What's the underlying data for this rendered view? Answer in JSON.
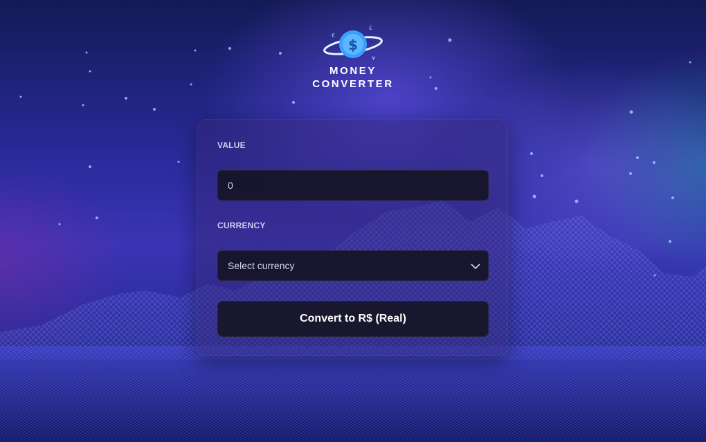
{
  "app": {
    "logo_line1": "MONEY",
    "logo_line2": "CONVERTER",
    "brand_color": "#3aa0ff",
    "accent_color": "#4a3fd0"
  },
  "form": {
    "value_label": "VALUE",
    "value_input": "0",
    "currency_label": "CURRENCY",
    "currency_selected": "Select currency",
    "convert_button": "Convert to R$ (Real)"
  },
  "icons": {
    "logo": "money-planet-icon",
    "select": "chevron-down-icon"
  }
}
